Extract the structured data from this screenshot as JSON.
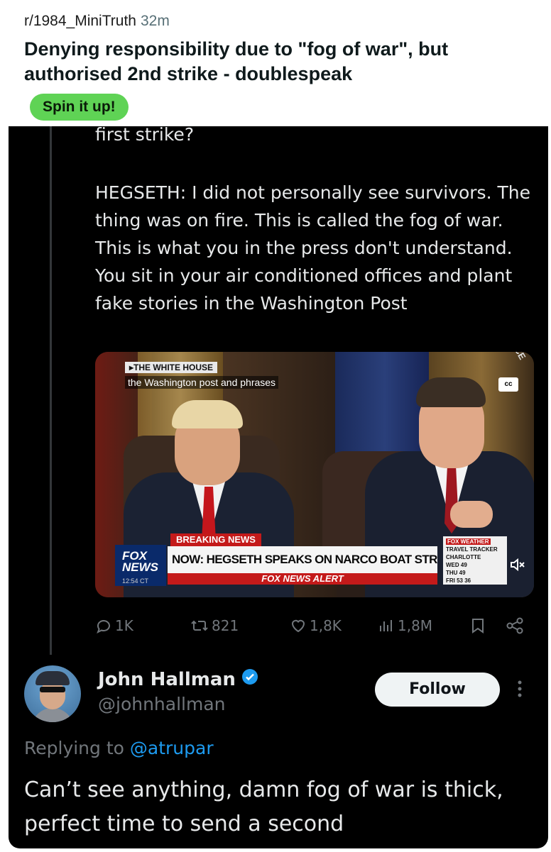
{
  "reddit": {
    "subreddit": "r/1984_MiniTruth",
    "age": "32m",
    "title": "Denying responsibility due to \"fog of war\", but authorised 2nd strike - doublespeak",
    "flair": "Spin it up!"
  },
  "tweet": {
    "cut_text": "first strike?",
    "quote": "HEGSETH: I did not personally see survivors. The thing was on fire. This is called the fog of war. This is what you in the press don't understand. You sit in your air conditioned offices and plant fake stories in the Washington Post",
    "video": {
      "source_tag": "▸THE WHITE HOUSE",
      "caption": "the Washington post and phrases",
      "cc": "cc",
      "corner": "ACE  RCE",
      "breaking": "BREAKING NEWS",
      "headline": "NOW: HEGSETH SPEAKS ON NARCO BOAT STRIKES",
      "alert": "FOX NEWS ALERT",
      "logo_top": "FOX",
      "logo_bottom": "NEWS",
      "time": "12:54 CT",
      "weather_title": "FOX WEATHER",
      "weather_sub": "TRAVEL TRACKER",
      "weather_city": "CHARLOTTE",
      "weather_rows": [
        "WED  49",
        "THU  49",
        "FRI  53  36"
      ]
    },
    "stats": {
      "replies": "1K",
      "reposts": "821",
      "likes": "1,8K",
      "views": "1,8M"
    }
  },
  "reply": {
    "name": "John Hallman",
    "handle": "@johnhallman",
    "follow_label": "Follow",
    "replying_prefix": "Replying to ",
    "replying_to": "@atrupar",
    "text": "Can’t see anything, damn fog of war is thick, perfect time to send a second"
  },
  "colors": {
    "x_background": "#000000",
    "x_text": "#e7e9ea",
    "x_muted": "#71767b",
    "x_link": "#1d9bf0",
    "verified": "#1d9bf0",
    "flair_green": "#5fd355"
  }
}
